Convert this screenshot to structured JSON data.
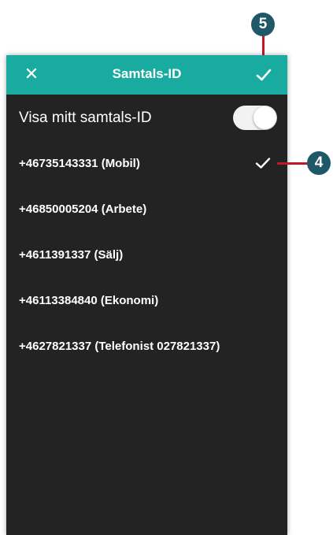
{
  "header": {
    "title": "Samtals-ID",
    "close_icon": "close-icon",
    "confirm_icon": "check-icon",
    "color": "#1aaba0"
  },
  "show_caller_id": {
    "label": "Visa mitt samtals-ID",
    "enabled": true
  },
  "numbers": [
    {
      "label": "+46735143331 (Mobil)",
      "selected": true
    },
    {
      "label": "+46850005204 (Arbete)",
      "selected": false
    },
    {
      "label": "+4611391337 (Sälj)",
      "selected": false
    },
    {
      "label": "+46113384840 (Ekonomi)",
      "selected": false
    },
    {
      "label": "+4627821337 (Telefonist 027821337)",
      "selected": false
    }
  ],
  "annotations": {
    "badge_confirm": "5",
    "badge_selected": "4",
    "badge_color": "#1f5968",
    "line_color": "#c0172a"
  }
}
